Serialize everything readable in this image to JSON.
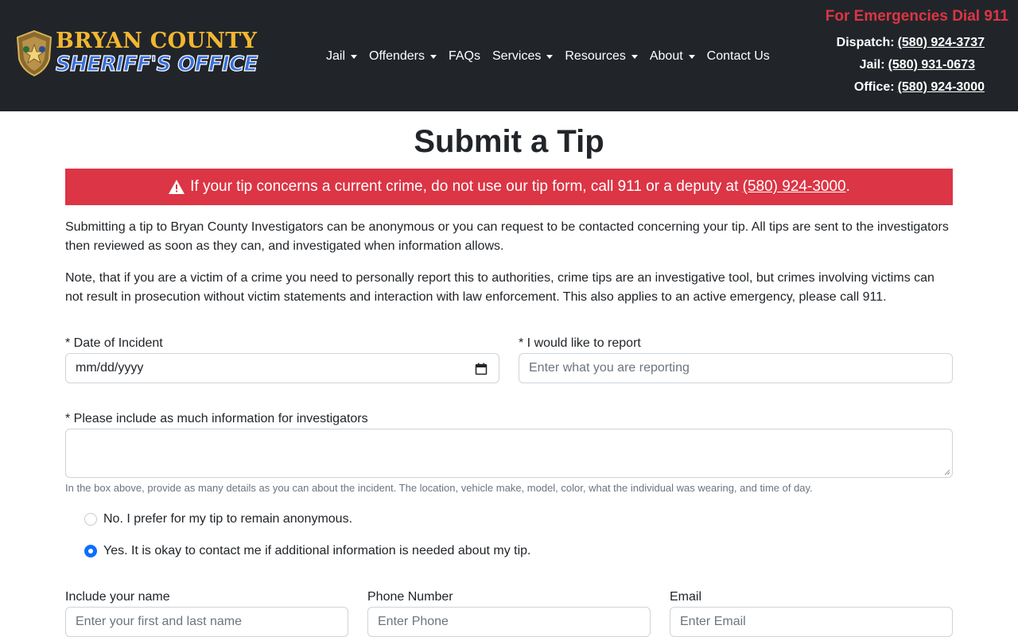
{
  "header": {
    "logo": {
      "line1": "BRYAN COUNTY",
      "line2": "SHERIFF'S OFFICE",
      "badge_icon": "sheriff-badge-icon"
    },
    "nav": [
      {
        "label": "Jail",
        "has_dropdown": true
      },
      {
        "label": "Offenders",
        "has_dropdown": true
      },
      {
        "label": "FAQs",
        "has_dropdown": false
      },
      {
        "label": "Services",
        "has_dropdown": true
      },
      {
        "label": "Resources",
        "has_dropdown": true
      },
      {
        "label": "About",
        "has_dropdown": true
      },
      {
        "label": "Contact Us",
        "has_dropdown": false
      }
    ],
    "emergency": "For Emergencies Dial 911",
    "dispatch_label": "Dispatch:",
    "dispatch_phone": "(580) 924-3737",
    "jail_label": "Jail:",
    "jail_phone": "(580) 931-0673",
    "office_label": "Office:",
    "office_phone": "(580) 924-3000"
  },
  "page": {
    "title": "Submit a Tip",
    "alert_text": "If your tip concerns a current crime, do not use our tip form, call 911 or a deputy at",
    "alert_phone": "(580) 924-3000",
    "alert_end": ".",
    "intro": "Submitting a tip to Bryan County Investigators can be anonymous or you can request to be contacted concerning your tip. All tips are sent to the investigators then reviewed as soon as they can, and investigated when information allows.",
    "note": "Note, that if you are a victim of a crime you need to personally report this to authorities, crime tips are an investigative tool, but crimes involving victims can not result in prosecution without victim statements and interaction with law enforcement. This also applies to an active emergency, please call 911."
  },
  "form": {
    "date_label": "* Date of Incident",
    "date_value": "mm/dd/yyyy",
    "report_label": "* I would like to report",
    "report_placeholder": "Enter what you are reporting",
    "details_label": "* Please include as much information for investigators",
    "details_help": "In the box above, provide as many details as you can about the incident. The location, vehicle make, model, color, what the individual was wearing, and time of day.",
    "contact_options": [
      {
        "label": "No. I prefer for my tip to remain anonymous.",
        "checked": false
      },
      {
        "label": "Yes. It is okay to contact me if additional information is needed about my tip.",
        "checked": true
      }
    ],
    "name_label": "Include your name",
    "name_placeholder": "Enter your first and last name",
    "phone_label": "Phone Number",
    "phone_placeholder": "Enter Phone",
    "email_label": "Email",
    "email_placeholder": "Enter Email"
  },
  "colors": {
    "header_bg": "#212529",
    "alert_bg": "#dc3545",
    "accent_blue": "#0d6efd",
    "logo_gold": "#f2b632"
  }
}
